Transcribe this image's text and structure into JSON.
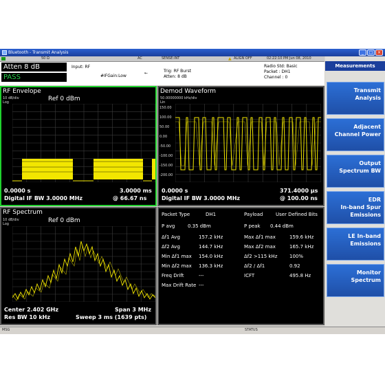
{
  "window": {
    "title": "Bluetooth - Transmit Analysis",
    "min": "_",
    "max": "□",
    "close": "×"
  },
  "status": {
    "left": "50 Ω",
    "coupling": "AC",
    "sense": "SENSE:INT",
    "align": "ALIGN OFF",
    "datetime": "02:22:10 PM Jun 08, 2010",
    "warn_color": "#e0c000"
  },
  "info": {
    "atten": "Atten  8 dB",
    "pass": "PASS",
    "input": "Input: RF",
    "ifgain": "#IFGain:Low",
    "trig": "Trig: RF Burst",
    "atten2": "Atten: 8 dB",
    "radio_std": "Radio Std: Basic",
    "packet": "Packet : DH1",
    "channel": "Channel : 0"
  },
  "rf_envelope": {
    "title": "RF Envelope",
    "ref": "Ref  0 dBm",
    "scale": "10 dB/div",
    "log": "Log",
    "start": "0.0000 s",
    "stop": "3.0000 ms",
    "bw": "Digital IF BW 3.0000 MHz",
    "rate": "@ 66.67 ns"
  },
  "demod": {
    "title": "Demod Waveform",
    "scale": "50.00000000 kHz/div",
    "lin": "Lin",
    "yticks": [
      "150.00",
      "100.00",
      "50.00",
      "0.00",
      "-50.00",
      "-100.00",
      "-150.00",
      "-200.00"
    ],
    "start": "0.0000 s",
    "stop": "371.4000 µs",
    "bw": "Digital IF BW 3.0000 MHz",
    "rate": "@ 100.00 ns"
  },
  "rf_spectrum": {
    "title": "RF Spectrum",
    "ref": "Ref  0 dBm",
    "scale": "10 dB/div",
    "log": "Log",
    "center": "Center  2.402 GHz",
    "span": "Span 3 MHz",
    "rbw": "Res BW  10 kHz",
    "sweep": "Sweep  3 ms (1639 pts)"
  },
  "results": {
    "packet_type_label": "Packet Type",
    "packet_type": "DH1",
    "payload_label": "Payload",
    "payload": "User Defined Bits",
    "pavg_label": "P avg",
    "pavg": "0.35 dBm",
    "ppeak_label": "P peak",
    "ppeak": "0.44 dBm",
    "rows": [
      {
        "l1": "Δf1 Avg",
        "v1": "157.2 kHz",
        "l2": "Max Δf1 max",
        "v2": "159.6 kHz"
      },
      {
        "l1": "Δf2 Avg",
        "v1": "144.7 kHz",
        "l2": "Max Δf2 max",
        "v2": "165.7 kHz"
      },
      {
        "l1": "Min Δf1 max",
        "v1": "154.0 kHz",
        "l2": "Δf2 >115 kHz",
        "v2": "100%"
      },
      {
        "l1": "Min Δf2 max",
        "v1": "136.3 kHz",
        "l2": "Δf2 / Δf1",
        "v2": "0.92"
      },
      {
        "l1": "Freq Drift",
        "v1": "---",
        "l2": "ICFT",
        "v2": "495.8 Hz"
      },
      {
        "l1": "Max Drift Rate",
        "v1": "---",
        "l2": "",
        "v2": ""
      }
    ]
  },
  "sidebar": {
    "title": "Measurements",
    "items": [
      {
        "line1": "Transmit",
        "line2": "Analysis",
        "line3": ""
      },
      {
        "line1": "Adjacent",
        "line2": "Channel Power",
        "line3": ""
      },
      {
        "line1": "Output",
        "line2": "Spectrum BW",
        "line3": ""
      },
      {
        "line1": "EDR",
        "line2": "In-band Spur",
        "line3": "Emissions"
      },
      {
        "line1": "LE In-band",
        "line2": "Emissions",
        "line3": ""
      },
      {
        "line1": "Monitor",
        "line2": "Spectrum",
        "line3": ""
      }
    ]
  },
  "bottom": {
    "msg": "MSG",
    "status": "STATUS"
  },
  "colors": {
    "trace": "#f2e600",
    "grid": "#3c3c3c",
    "sel_border": "#1fd12e",
    "accent": "#1b3f9c"
  }
}
